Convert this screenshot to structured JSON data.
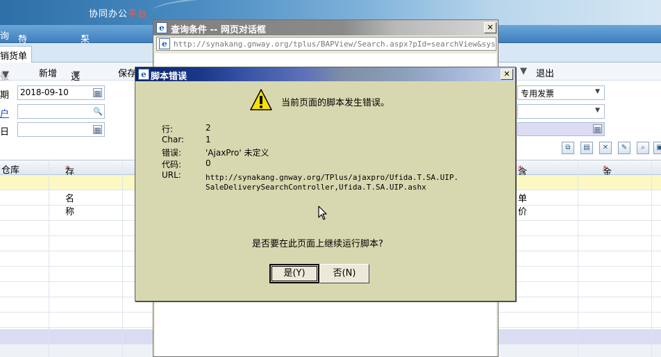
{
  "app": {
    "title_main": "协同办公",
    "title_mark": "平台",
    "menu": {
      "item1": "询",
      "item2": "待审核业务",
      "item3": "采购价格查询"
    },
    "tab_active": "销货单",
    "toolbar": {
      "prev": "张",
      "new": "新增",
      "select": "选单",
      "save": "保存",
      "exit": "退出"
    },
    "form": {
      "date_label": "期",
      "date_value": "2018-09-10",
      "customer_label": "户",
      "third_label": "日",
      "invoice_type": "专用发票"
    },
    "grid": {
      "headers": {
        "warehouse": "仓库",
        "item_name": "存货名称",
        "tax_price": "含税单价",
        "amount": "金额"
      },
      "required_mark": "*"
    }
  },
  "query_dialog": {
    "title": "查询条件 -- 网页对话框",
    "address": "http://synakang.gnway.org/tplus/BAPView/Search.aspx?pId=searchView&sysZ"
  },
  "error_dialog": {
    "title": "脚本错误",
    "headline": "当前页面的脚本发生错误。",
    "fields": {
      "line_label": "行:",
      "line_value": "2",
      "char_label": "Char:",
      "char_value": "1",
      "error_label": "错误:",
      "error_value": "'AjaxPro' 未定义",
      "code_label": "代码:",
      "code_value": "0",
      "url_label": "URL:",
      "url_value_1": "http://synakang.gnway.org/TPlus/ajaxpro/Ufida.T.SA.UIP.",
      "url_value_2": "SaleDeliverySearchController,Ufida.T.SA.UIP.ashx"
    },
    "question": "是否要在此页面上继续运行脚本?",
    "yes_button": "是(Y)",
    "no_button": "否(N)"
  },
  "icons": {
    "ie": "ie-icon",
    "warning": "warning-icon",
    "close": "close-icon",
    "calendar": "calendar-icon",
    "search": "search-icon",
    "cursor": "mouse-cursor-icon"
  }
}
